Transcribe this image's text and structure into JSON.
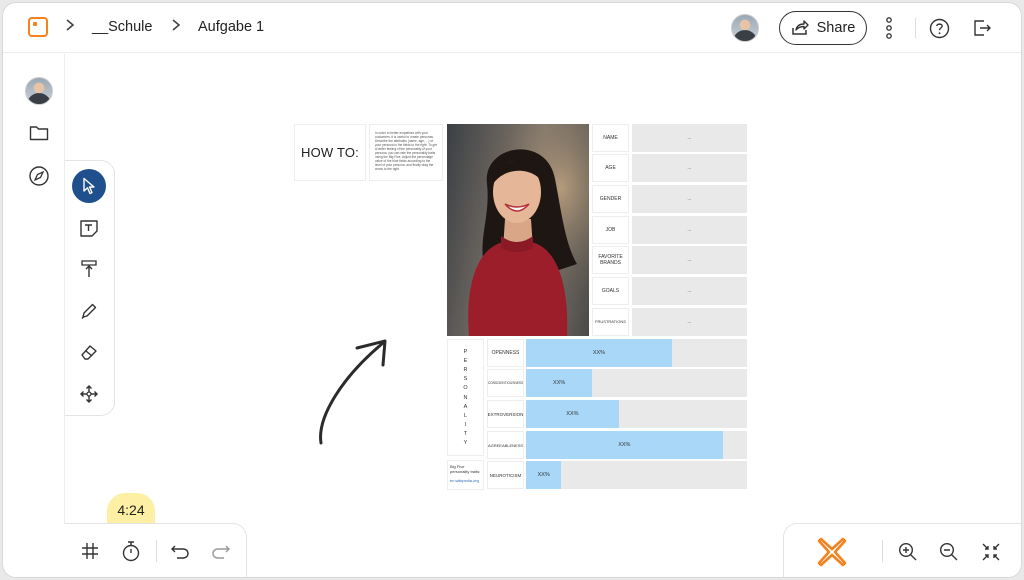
{
  "breadcrumb": {
    "items": [
      "__Schule",
      "Aufgabe 1"
    ]
  },
  "toolbar": {
    "share_label": "Share"
  },
  "timer": {
    "value": "4:24"
  },
  "board": {
    "howto_title": "HOW TO:",
    "howto_text": "In order to better empathize with your customers, it is useful to create personas. Describe the attributes (name, age, ...) of your persona in the fields to the right. To get a better feeling of the personality of your persona, you can rate the personality traits using the Big Five. Adjust the percentage value of the blue fields according to the level of your persona, and finally drag the arrow to the right.",
    "fields": [
      {
        "label": "NAME",
        "value": "..."
      },
      {
        "label": "AGE",
        "value": "..."
      },
      {
        "label": "GENDER",
        "value": "..."
      },
      {
        "label": "JOB",
        "value": "..."
      },
      {
        "label": "FAVORITE BRANDS",
        "value": "..."
      },
      {
        "label": "GOALS",
        "value": "..."
      },
      {
        "label": "FRUSTRATIONS",
        "value": "..."
      }
    ],
    "personality_letters": [
      "P",
      "E",
      "R",
      "S",
      "O",
      "N",
      "A",
      "L",
      "I",
      "T",
      "Y"
    ],
    "traits": [
      {
        "label": "OPENNESS",
        "value": "XX%",
        "fill": 0.66
      },
      {
        "label": "CONSCIENTIOUSNESS",
        "value": "XX%",
        "fill": 0.3
      },
      {
        "label": "EXTROVERSION",
        "value": "XX%",
        "fill": 0.42
      },
      {
        "label": "AGREEABLENESS",
        "value": "XX%",
        "fill": 0.89
      },
      {
        "label": "NEUROTICISM",
        "value": "XX%",
        "fill": 0.16
      }
    ],
    "bigfive_note": "Big Five personality traits:",
    "bigfive_link": "en.wikipedia.org"
  },
  "colors": {
    "accent_orange": "#f5821f",
    "active_tool": "#1f4f8c",
    "trait_fill": "#a9d7f7",
    "timer_bg": "#fdf0a5"
  }
}
